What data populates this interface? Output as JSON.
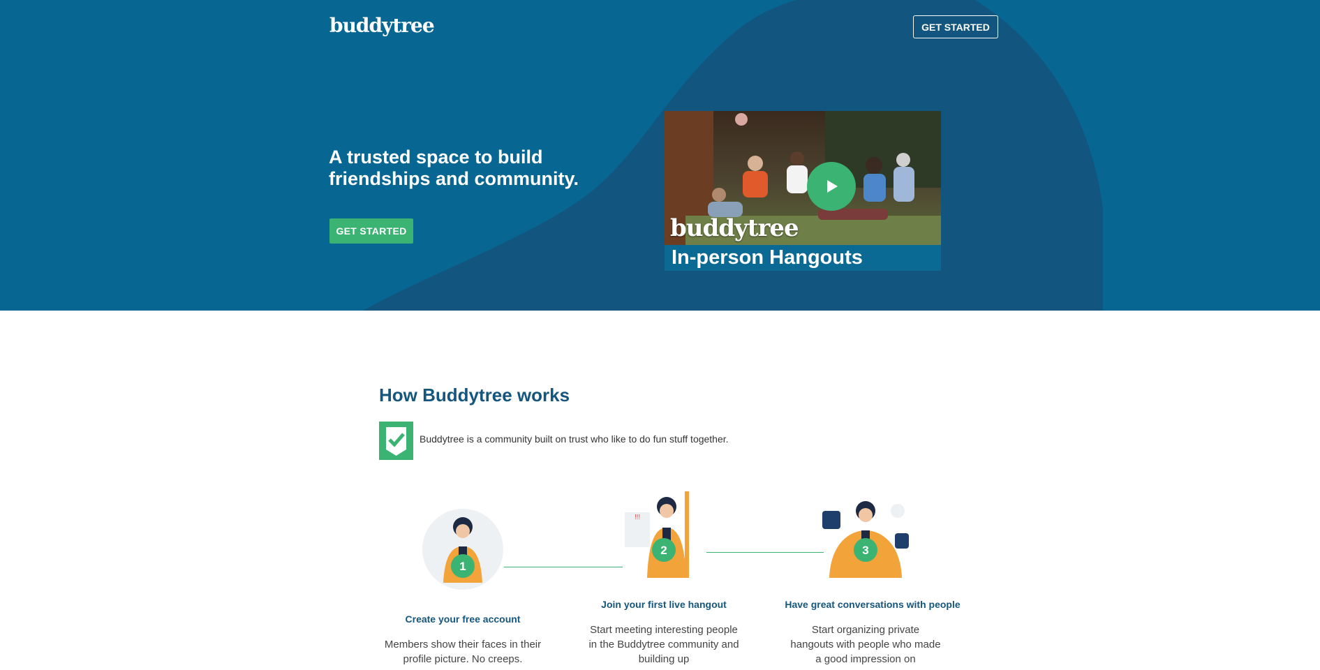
{
  "header": {
    "logo": "buddytree",
    "get_started_label": "GET STARTED"
  },
  "hero": {
    "title": "A trusted space to build friendships and community.",
    "cta_label": "GET STARTED",
    "video": {
      "brand": "buddytree",
      "caption": "In-person Hangouts"
    }
  },
  "how": {
    "title": "How Buddytree works",
    "trust_text": "Buddytree is a community built on trust who like to do fun stuff together.",
    "steps": [
      {
        "number": "1",
        "title": "Create your free account",
        "text": "Members show their faces in their profile picture. No creeps."
      },
      {
        "number": "2",
        "title": "Join your first live hangout",
        "text": "Start meeting interesting people in the Buddytree community and building up"
      },
      {
        "number": "3",
        "title": "Have great conversations with people",
        "text": "Start organizing private hangouts with people who made a good impression on"
      }
    ]
  },
  "colors": {
    "hero_bg": "#076692",
    "hero_blob": "#12557e",
    "accent_green": "#3bb372",
    "heading_blue": "#15567e",
    "character_orange": "#f2a33a"
  }
}
